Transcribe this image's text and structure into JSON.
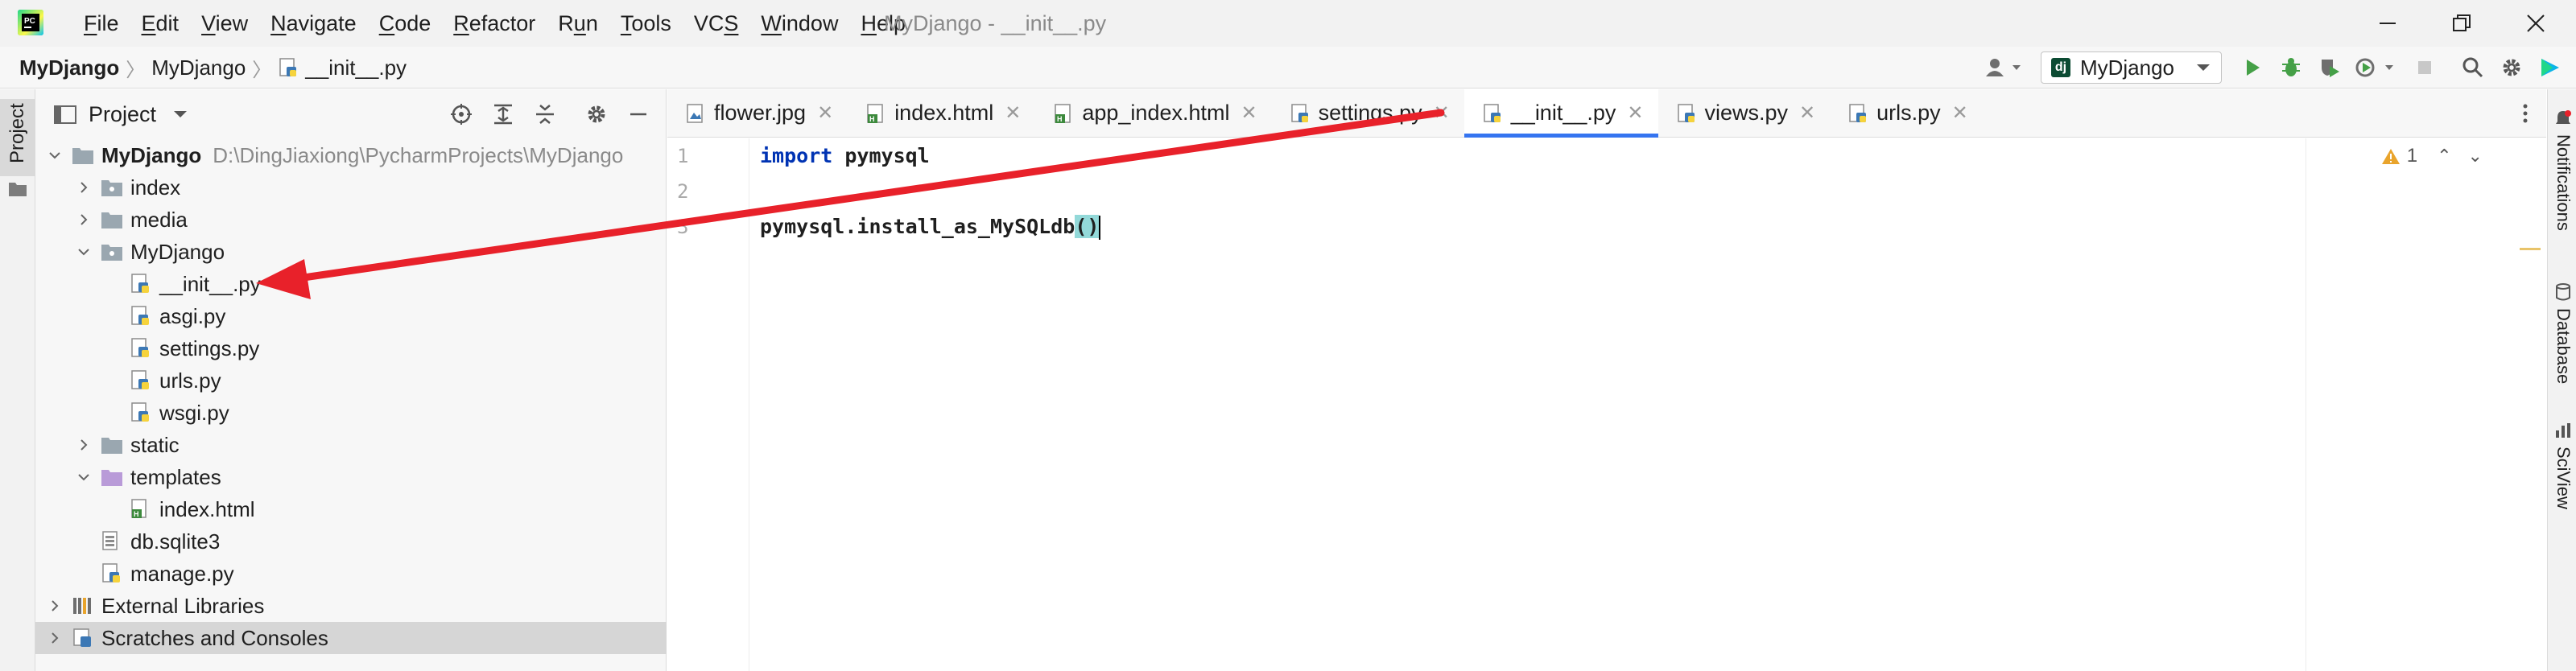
{
  "window": {
    "title": "MyDjango - __init__.py",
    "menu": [
      {
        "pre": "",
        "u": "F",
        "post": "ile"
      },
      {
        "pre": "",
        "u": "E",
        "post": "dit"
      },
      {
        "pre": "",
        "u": "V",
        "post": "iew"
      },
      {
        "pre": "",
        "u": "N",
        "post": "avigate"
      },
      {
        "pre": "",
        "u": "C",
        "post": "ode"
      },
      {
        "pre": "",
        "u": "R",
        "post": "efactor"
      },
      {
        "pre": "R",
        "u": "u",
        "post": "n"
      },
      {
        "pre": "",
        "u": "T",
        "post": "ools"
      },
      {
        "pre": "VC",
        "u": "S",
        "post": ""
      },
      {
        "pre": "",
        "u": "W",
        "post": "indow"
      },
      {
        "pre": "",
        "u": "H",
        "post": "elp"
      }
    ]
  },
  "breadcrumb": [
    "MyDjango",
    "MyDjango",
    "__init__.py"
  ],
  "run_config": {
    "label": "MyDjango",
    "badge": "dj"
  },
  "project_panel": {
    "title": "Project",
    "root_path": "D:\\DingJiaxiong\\PycharmProjects\\MyDjango",
    "tree": [
      {
        "label": "MyDjango"
      },
      {
        "label": "index"
      },
      {
        "label": "media"
      },
      {
        "label": "MyDjango"
      },
      {
        "label": "__init__.py"
      },
      {
        "label": "asgi.py"
      },
      {
        "label": "settings.py"
      },
      {
        "label": "urls.py"
      },
      {
        "label": "wsgi.py"
      },
      {
        "label": "static"
      },
      {
        "label": "templates"
      },
      {
        "label": "index.html"
      },
      {
        "label": "db.sqlite3"
      },
      {
        "label": "manage.py"
      },
      {
        "label": "External Libraries"
      },
      {
        "label": "Scratches and Consoles"
      }
    ]
  },
  "editor": {
    "tabs": [
      {
        "label": "flower.jpg",
        "active": false
      },
      {
        "label": "index.html",
        "active": false
      },
      {
        "label": "app_index.html",
        "active": false
      },
      {
        "label": "settings.py",
        "active": false
      },
      {
        "label": "__init__.py",
        "active": true
      },
      {
        "label": "views.py",
        "active": false
      },
      {
        "label": "urls.py",
        "active": false
      }
    ],
    "line_numbers": [
      "1",
      "2",
      "3"
    ],
    "code": {
      "line1_kw": "import",
      "line1_rest": " pymysql",
      "line3_text": "pymysql.install_as_MySQLdb",
      "line3_paren_open": "(",
      "line3_paren_close": ")"
    },
    "inspections": {
      "warnings": "1"
    }
  },
  "right_tools": [
    "Notifications",
    "Database",
    "SciView"
  ],
  "colors": {
    "accent": "#3574f0",
    "annotation_arrow": "#e8212a",
    "keyword": "#0033b3",
    "paren_highlight": "#93d9d9"
  }
}
